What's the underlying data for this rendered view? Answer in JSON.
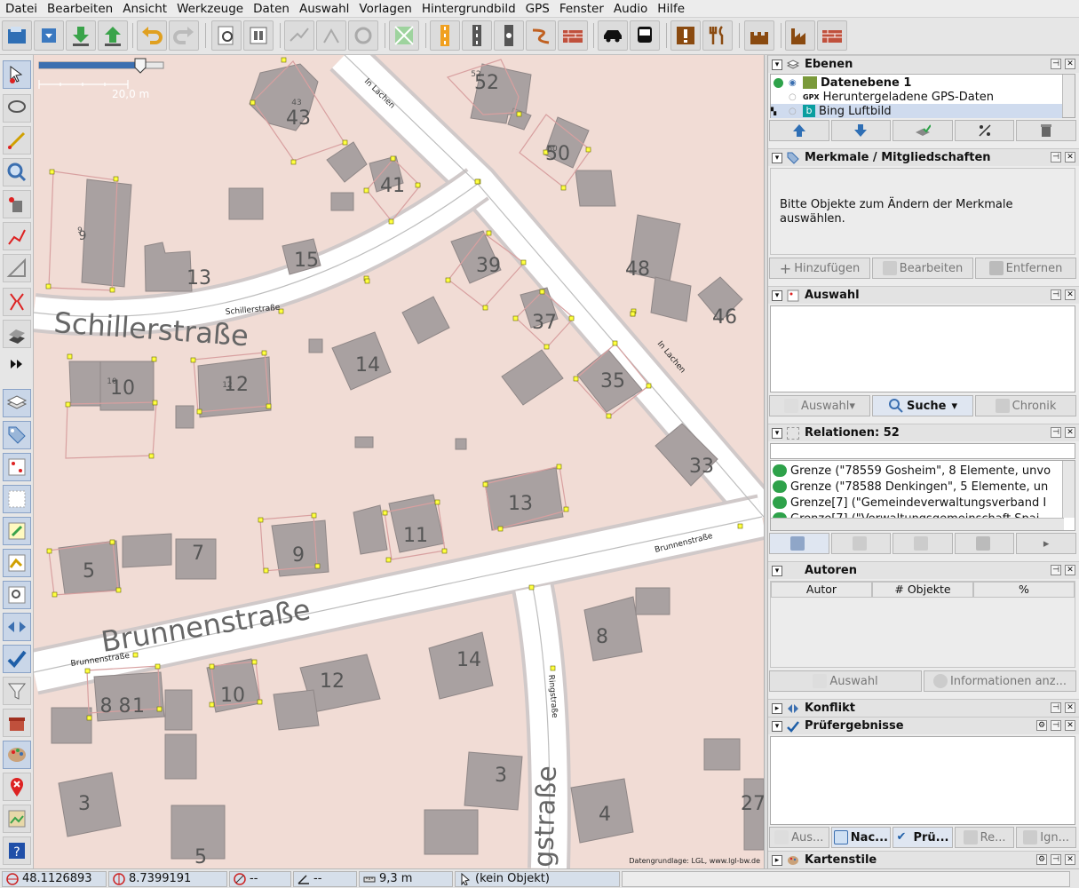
{
  "menubar": {
    "items": [
      "Datei",
      "Bearbeiten",
      "Ansicht",
      "Werkzeuge",
      "Daten",
      "Auswahl",
      "Vorlagen",
      "Hintergrundbild",
      "GPS",
      "Fenster",
      "Audio",
      "Hilfe"
    ]
  },
  "toolbar": {
    "buttons": [
      "open-file-icon",
      "download-icon",
      "download-data-icon",
      "upload-icon",
      "undo-icon",
      "redo-icon",
      "preferences-icon",
      "toggle-icon",
      "simplify-icon",
      "merge-nodes-icon",
      "refresh-icon",
      "wireframe-icon",
      "road-major-icon",
      "road-minor-icon",
      "track-icon",
      "path-icon",
      "wall-icon",
      "car-icon",
      "bus-icon",
      "danger-icon",
      "restaurant-icon",
      "castle-icon",
      "industry-icon",
      "brick-wall-icon"
    ]
  },
  "map": {
    "scale_label": "20,0 m",
    "attribution": "Datengrundlage: LGL, www.lgl-bw.de",
    "street_names": [
      "Schillerstraße",
      "Schillerstraße",
      "Brunnenstraße",
      "Brunnenstraße",
      "In Lachen",
      "In Lachen",
      "Ringstraße",
      "gstraße"
    ],
    "house_numbers": [
      "52",
      "43",
      "9",
      "13",
      "15",
      "41",
      "50",
      "39",
      "48",
      "37",
      "46",
      "35",
      "10",
      "12",
      "14",
      "33",
      "13",
      "11",
      "9",
      "7",
      "5",
      "8",
      "14",
      "8 8",
      "1",
      "10",
      "12",
      "3",
      "4",
      "27",
      "3",
      "5"
    ],
    "small_numbers": [
      "52",
      "43",
      "9",
      "10",
      "12",
      "50"
    ]
  },
  "layers_panel": {
    "title": "Ebenen",
    "layers": [
      {
        "name": "Datenebene 1",
        "active": true
      },
      {
        "name": "Heruntergeladene GPS-Daten",
        "active": false
      },
      {
        "name": "Bing Luftbild",
        "active": false
      }
    ]
  },
  "tags_panel": {
    "title": "Merkmale / Mitgliedschaften",
    "message": "Bitte Objekte zum Ändern der Merkmale auswählen.",
    "buttons": [
      "Hinzufügen",
      "Bearbeiten",
      "Entfernen"
    ]
  },
  "selection_panel": {
    "title": "Auswahl",
    "buttons": [
      "Auswahl",
      "Suche",
      "Chronik"
    ]
  },
  "relations_panel": {
    "title": "Relationen: 52",
    "items": [
      "Grenze (\"78559 Gosheim\", 8 Elemente, unvo",
      "Grenze (\"78588 Denkingen\", 5 Elemente, un",
      "Grenze[7] (\"Gemeindeverwaltungsverband I",
      "Grenze[7] (\"Verwaltungsgemeinschaft Spai"
    ]
  },
  "authors_panel": {
    "title": "Autoren",
    "columns": [
      "Autor",
      "# Objekte",
      "%"
    ],
    "buttons": [
      "Auswahl",
      "Informationen anz..."
    ]
  },
  "conflict_panel": {
    "title": "Konflikt"
  },
  "validator_panel": {
    "title": "Prüfergebnisse",
    "buttons": [
      "Aus...",
      "Nac...",
      "Prü...",
      "Re...",
      "Ign..."
    ]
  },
  "mapstyles_panel": {
    "title": "Kartenstile"
  },
  "statusbar": {
    "lat": "48.1126893",
    "lon": "8.7399191",
    "heading": "--",
    "angle": "--",
    "distance": "9,3 m",
    "object": "(kein Objekt)"
  },
  "colors": {
    "map_background": "#f1dcd5",
    "building": "#a9a1a1",
    "road": "#ffffff",
    "node": "#ffff00",
    "selection_blue": "#d6dfea"
  }
}
